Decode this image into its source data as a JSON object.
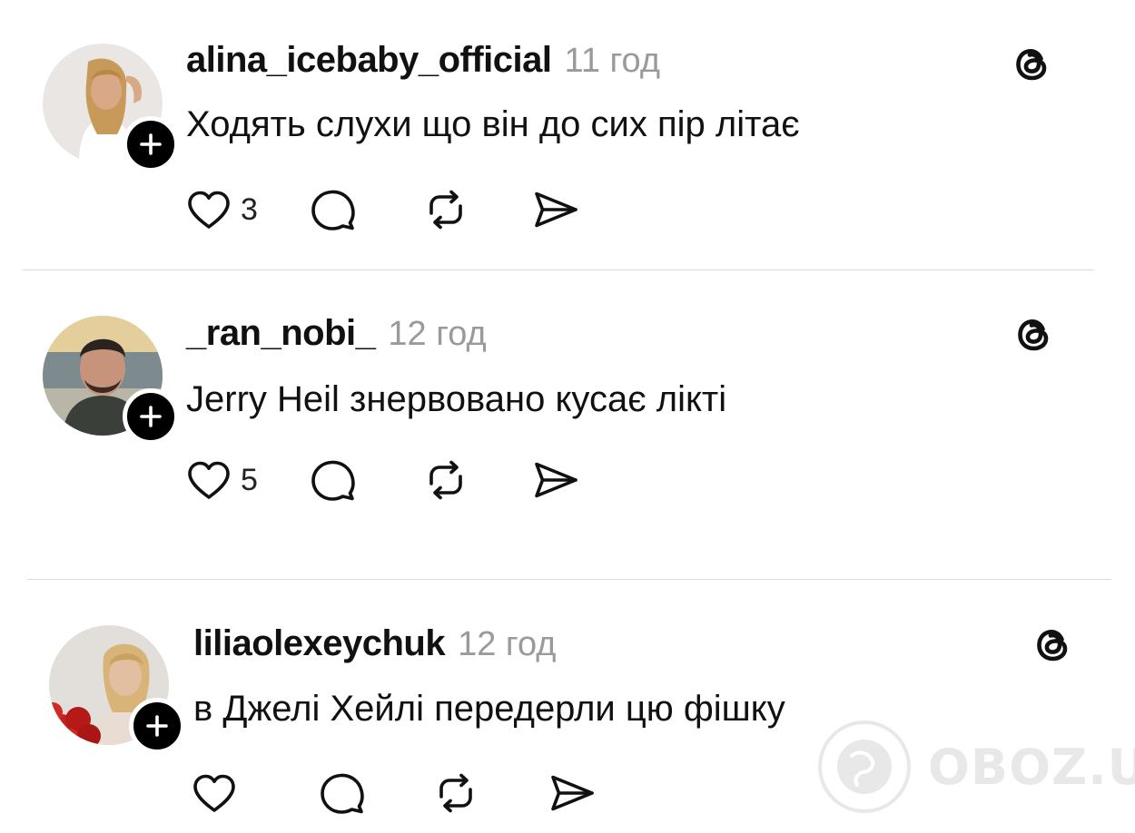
{
  "posts": [
    {
      "username": "alina_icebaby_official",
      "time": "11 год",
      "text": "Ходять слухи що він до сих пір літає",
      "like_count": "3",
      "avatar_icon": "woman-selfie-photo",
      "colors": {
        "avatar_bg": "#e9e6e3",
        "skin": "#d9a887",
        "hair": "#c89a5a",
        "top": "#ffffff"
      }
    },
    {
      "username": "_ran_nobi_",
      "time": "12 год",
      "text": "Jerry Heil знервовано кусає лікті",
      "like_count": "5",
      "avatar_icon": "man-sunset-photo",
      "colors": {
        "avatar_bg": "#b9b6a8",
        "skin": "#c7937a",
        "hair": "#2a2320",
        "top": "#3b3f3a"
      }
    },
    {
      "username": "liliaolexeychuk",
      "time": "12 год",
      "text": "в Джелі Хейлі передерли цю фішку",
      "like_count": "",
      "avatar_icon": "woman-roses-photo",
      "colors": {
        "avatar_bg": "#e2dfdb",
        "skin": "#e3bfa2",
        "hair": "#d9b478",
        "top": "#e8dcd3",
        "roses": "#c8201e"
      }
    }
  ],
  "watermark": {
    "text": "OBOZ.UA"
  },
  "icons": {
    "follow": "plus-icon",
    "like": "heart-icon",
    "reply": "comment-bubble-icon",
    "repost": "repost-icon",
    "share": "send-icon",
    "app": "threads-logo-icon"
  }
}
